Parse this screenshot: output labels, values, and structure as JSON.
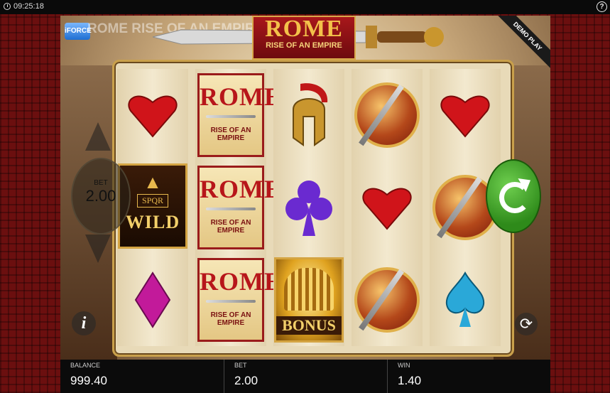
{
  "status_bar": {
    "time": "09:25:18"
  },
  "game": {
    "title_line1": "ROME",
    "title_line2": "RISE OF AN EMPIRE",
    "ghost_title": "ROME RISE OF AN EMPIRE",
    "provider_badge": "iFORCE",
    "demo_label": "DEMO PLAY",
    "reels": [
      [
        "heart",
        "wild",
        "diamond"
      ],
      [
        "rome",
        "rome",
        "rome"
      ],
      [
        "helmet",
        "club",
        "bonus"
      ],
      [
        "shield",
        "heart",
        "shield"
      ],
      [
        "heart",
        "shield",
        "spade"
      ]
    ],
    "symbols": {
      "rome_line1": "ROME",
      "rome_line2": "RISE OF AN EMPIRE",
      "wild_label": "WILD",
      "wild_emblem": "SPQR",
      "bonus_label": "BONUS"
    }
  },
  "controls": {
    "bet_label": "BET",
    "bet_value": "2.00",
    "info_label": "i"
  },
  "bottom_bar": {
    "balance_label": "BALANCE",
    "balance_value": "999.40",
    "bet_label": "BET",
    "bet_value": "2.00",
    "win_label": "WIN",
    "win_value": "1.40"
  },
  "colors": {
    "background": "#6b0f0f",
    "spin": "#2e8a1a",
    "gold": "#d4a442",
    "red_symbol": "#d0141a"
  }
}
